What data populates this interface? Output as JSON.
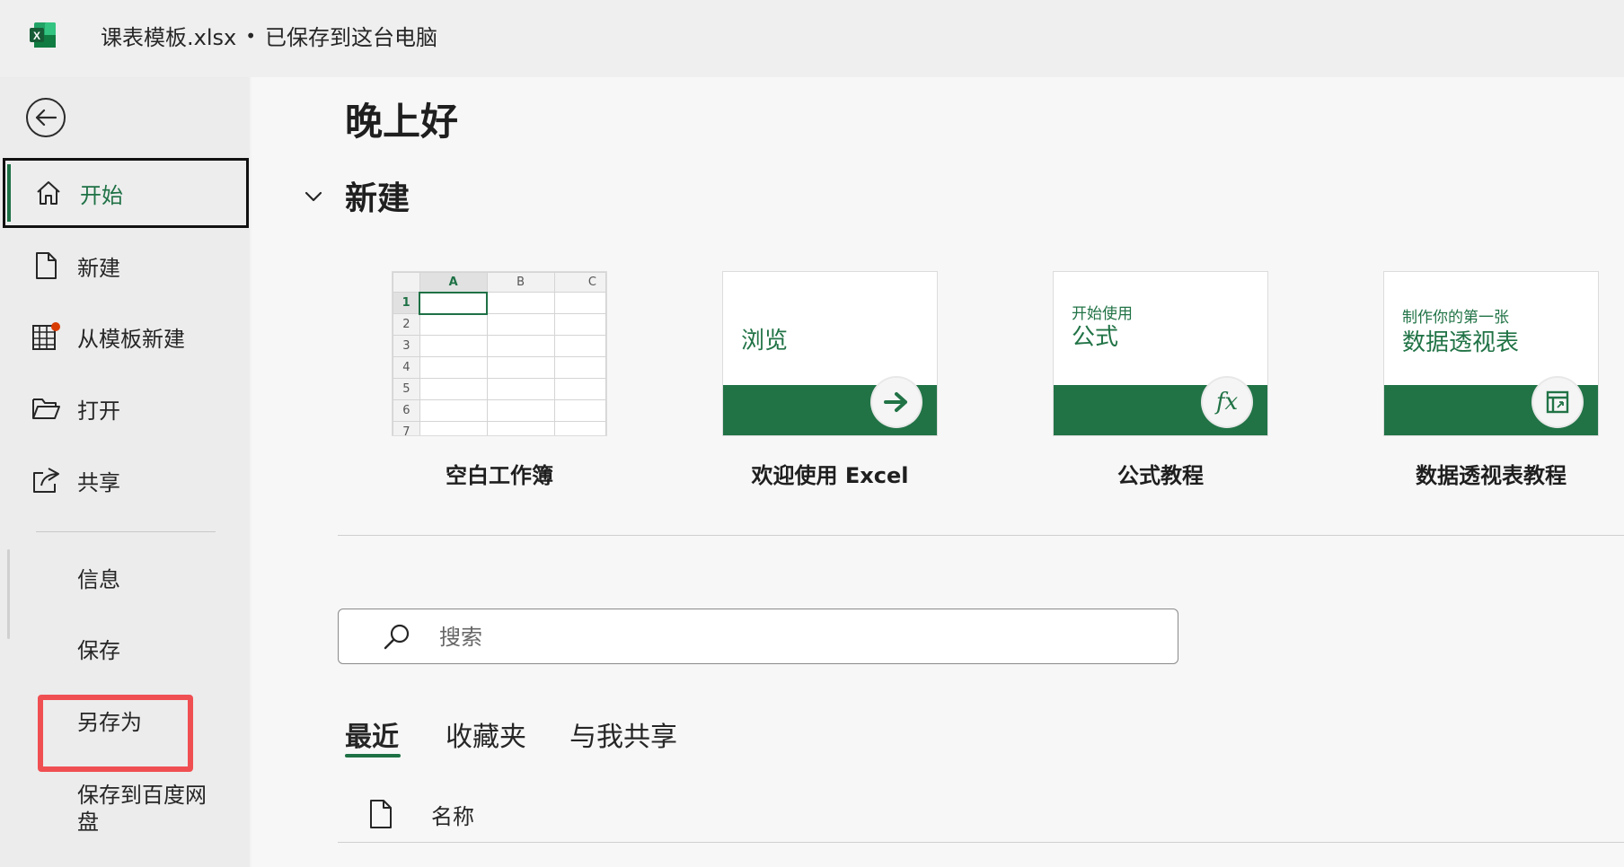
{
  "titlebar": {
    "filename": "课表模板.xlsx",
    "separator": "•",
    "save_status": "已保存到这台电脑",
    "logo_icon": "excel-logo-icon"
  },
  "sidebar": {
    "back_icon": "back-arrow-icon",
    "nav": [
      {
        "label": "开始",
        "icon": "home-icon",
        "active": true
      },
      {
        "label": "新建",
        "icon": "new-document-icon",
        "active": false
      },
      {
        "label": "从模板新建",
        "icon": "template-icon",
        "active": false
      },
      {
        "label": "打开",
        "icon": "folder-open-icon",
        "active": false
      },
      {
        "label": "共享",
        "icon": "share-icon",
        "active": false
      }
    ],
    "sub_items": [
      "信息",
      "保存",
      "另存为",
      "保存到百度网盘"
    ],
    "highlighted_item": "另存为"
  },
  "main": {
    "greeting": "晚上好",
    "new_section_title": "新建",
    "templates": [
      {
        "caption": "空白工作簿",
        "columns": [
          "A",
          "B",
          "C"
        ],
        "rows": [
          "1",
          "2",
          "3",
          "4",
          "5",
          "6",
          "7"
        ]
      },
      {
        "caption": "欢迎使用 Excel",
        "thumb_text": "浏览",
        "badge_icon": "arrow-right-icon"
      },
      {
        "caption": "公式教程",
        "thumb_small": "开始使用",
        "thumb_text": "公式",
        "badge_icon": "fx-icon",
        "badge_text": "fx"
      },
      {
        "caption": "数据透视表教程",
        "thumb_small": "制作你的第一张",
        "thumb_text": "数据透视表",
        "badge_icon": "pivot-table-icon"
      }
    ],
    "search": {
      "placeholder": "搜索",
      "value": ""
    },
    "tabs": [
      {
        "label": "最近",
        "active": true
      },
      {
        "label": "收藏夹",
        "active": false
      },
      {
        "label": "与我共享",
        "active": false
      }
    ],
    "list_header": {
      "name_col": "名称"
    }
  },
  "colors": {
    "accent_green": "#1e7145",
    "band_green": "#217346",
    "highlight_red": "#f04f52"
  }
}
